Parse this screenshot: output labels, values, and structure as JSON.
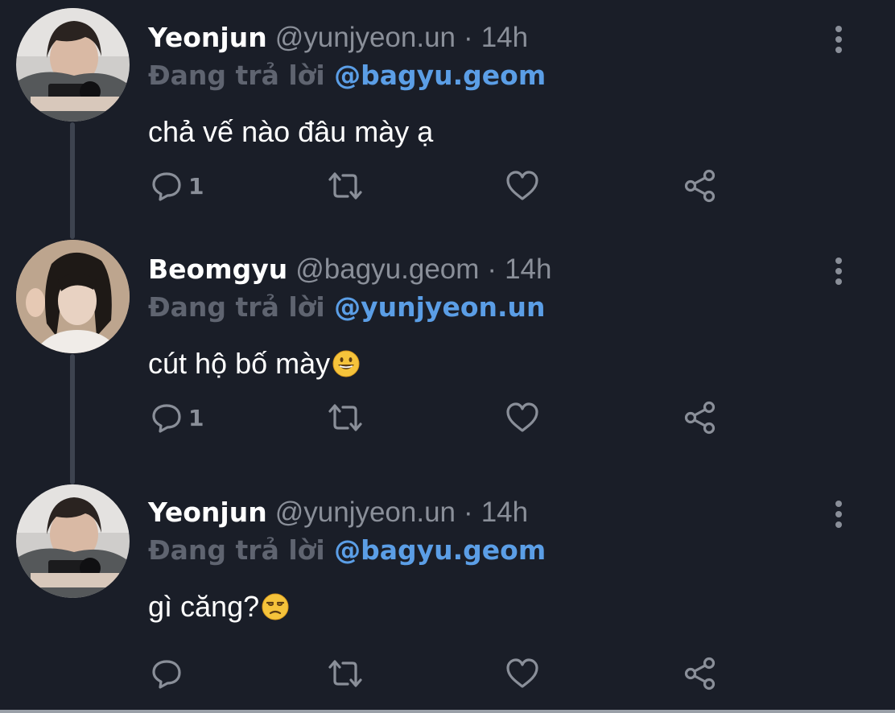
{
  "theme": {
    "background": "#1a1e28",
    "text": "#ffffff",
    "muted": "#8a8f99",
    "mention": "#5b9ee6",
    "thread_line": "#3d434f"
  },
  "tweets": [
    {
      "name": "Yeonjun",
      "handle": "@yunjyeon.un",
      "separator": "·",
      "time": "14h",
      "reply_prefix": "Đang trả lời",
      "reply_to": "@bagyu.geom",
      "text": "chả vế nào đâu mày ạ",
      "emoji": "",
      "reply_count": "1",
      "icons": [
        "reply-icon",
        "retweet-icon",
        "like-icon",
        "share-icon",
        "more-icon"
      ]
    },
    {
      "name": "Beomgyu",
      "handle": "@bagyu.geom",
      "separator": "·",
      "time": "14h",
      "reply_prefix": "Đang trả lời",
      "reply_to": "@yunjyeon.un",
      "text": "cút hộ bố mày",
      "emoji": "grinning-face-emoji",
      "reply_count": "1",
      "icons": [
        "reply-icon",
        "retweet-icon",
        "like-icon",
        "share-icon",
        "more-icon"
      ]
    },
    {
      "name": "Yeonjun",
      "handle": "@yunjyeon.un",
      "separator": "·",
      "time": "14h",
      "reply_prefix": "Đang trả lời",
      "reply_to": "@bagyu.geom",
      "text": "gì căng?",
      "emoji": "unamused-face-emoji",
      "reply_count": "",
      "icons": [
        "reply-icon",
        "retweet-icon",
        "like-icon",
        "share-icon",
        "more-icon"
      ]
    }
  ]
}
